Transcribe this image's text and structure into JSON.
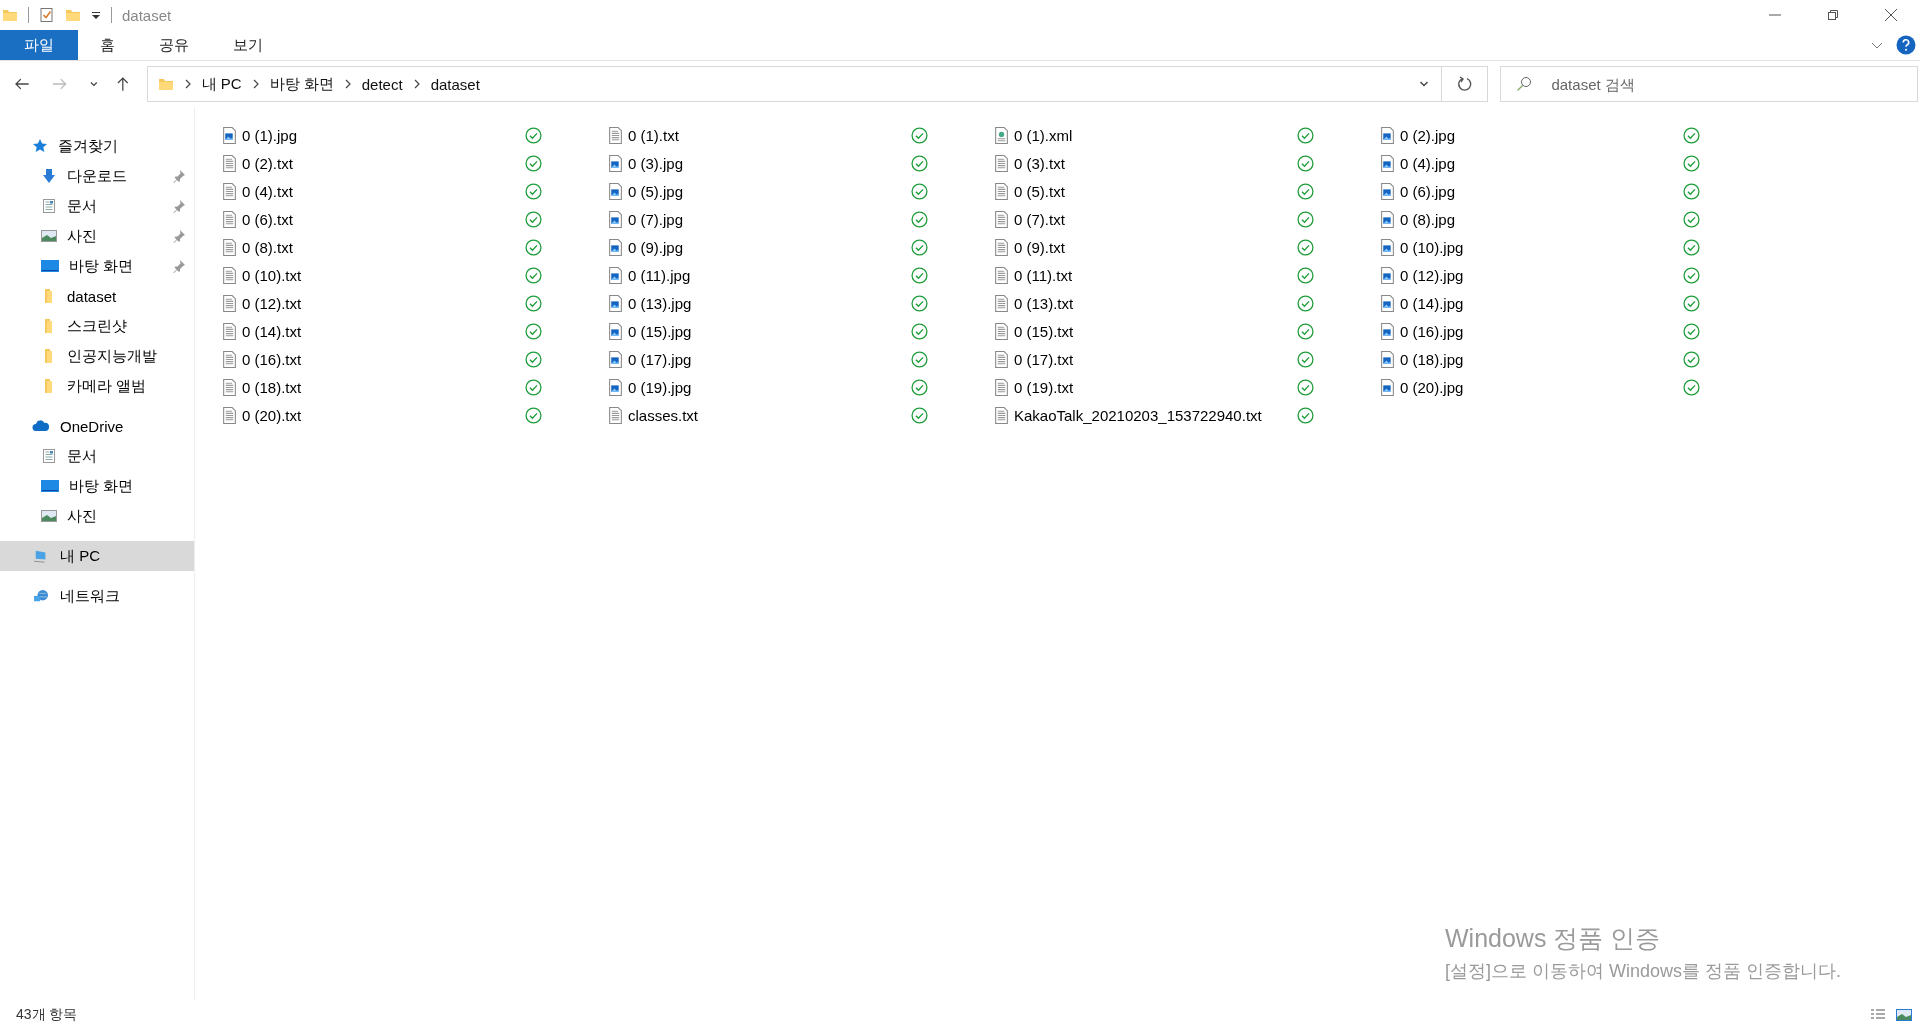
{
  "window": {
    "title": "dataset"
  },
  "ribbon_tabs": [
    {
      "label": "파일",
      "selected": true
    },
    {
      "label": "홈",
      "selected": false
    },
    {
      "label": "공유",
      "selected": false
    },
    {
      "label": "보기",
      "selected": false
    }
  ],
  "breadcrumb": [
    "내 PC",
    "바탕 화면",
    "detect",
    "dataset"
  ],
  "search": {
    "placeholder": "dataset 검색"
  },
  "sidebar": [
    {
      "label": "즐겨찾기",
      "kind": "star",
      "selected": false,
      "children": [
        {
          "label": "다운로드",
          "kind": "download",
          "pinned": true,
          "selected": false
        },
        {
          "label": "문서",
          "kind": "document",
          "pinned": true,
          "selected": false
        },
        {
          "label": "사진",
          "kind": "picture",
          "pinned": true,
          "selected": false
        },
        {
          "label": "바탕 화면",
          "kind": "desktop",
          "pinned": true,
          "selected": false
        },
        {
          "label": "dataset",
          "kind": "folder",
          "pinned": false,
          "selected": false
        },
        {
          "label": "스크린샷",
          "kind": "folder",
          "pinned": false,
          "selected": false
        },
        {
          "label": "인공지능개발",
          "kind": "folder",
          "pinned": false,
          "selected": false
        },
        {
          "label": "카메라 앨범",
          "kind": "folder",
          "pinned": false,
          "selected": false
        }
      ]
    },
    {
      "label": "OneDrive",
      "kind": "cloud",
      "selected": false,
      "children": [
        {
          "label": "문서",
          "kind": "document",
          "pinned": false,
          "selected": false
        },
        {
          "label": "바탕 화면",
          "kind": "desktop",
          "pinned": false,
          "selected": false
        },
        {
          "label": "사진",
          "kind": "picture",
          "pinned": false,
          "selected": false
        }
      ]
    },
    {
      "label": "내 PC",
      "kind": "pc",
      "selected": true
    },
    {
      "label": "네트워크",
      "kind": "network",
      "selected": false
    }
  ],
  "files": [
    {
      "name": "0 (1).jpg",
      "kind": "image",
      "synced": true
    },
    {
      "name": "0 (1).txt",
      "kind": "text",
      "synced": true
    },
    {
      "name": "0 (1).xml",
      "kind": "xml",
      "synced": true
    },
    {
      "name": "0 (2).jpg",
      "kind": "image",
      "synced": true
    },
    {
      "name": "0 (2).txt",
      "kind": "text",
      "synced": true
    },
    {
      "name": "0 (3).jpg",
      "kind": "image",
      "synced": true
    },
    {
      "name": "0 (3).txt",
      "kind": "text",
      "synced": true
    },
    {
      "name": "0 (4).jpg",
      "kind": "image",
      "synced": true
    },
    {
      "name": "0 (4).txt",
      "kind": "text",
      "synced": true
    },
    {
      "name": "0 (5).jpg",
      "kind": "image",
      "synced": true
    },
    {
      "name": "0 (5).txt",
      "kind": "text",
      "synced": true
    },
    {
      "name": "0 (6).jpg",
      "kind": "image",
      "synced": true
    },
    {
      "name": "0 (6).txt",
      "kind": "text",
      "synced": true
    },
    {
      "name": "0 (7).jpg",
      "kind": "image",
      "synced": true
    },
    {
      "name": "0 (7).txt",
      "kind": "text",
      "synced": true
    },
    {
      "name": "0 (8).jpg",
      "kind": "image",
      "synced": true
    },
    {
      "name": "0 (8).txt",
      "kind": "text",
      "synced": true
    },
    {
      "name": "0 (9).jpg",
      "kind": "image",
      "synced": true
    },
    {
      "name": "0 (9).txt",
      "kind": "text",
      "synced": true
    },
    {
      "name": "0 (10).jpg",
      "kind": "image",
      "synced": true
    },
    {
      "name": "0 (10).txt",
      "kind": "text",
      "synced": true
    },
    {
      "name": "0 (11).jpg",
      "kind": "image",
      "synced": true
    },
    {
      "name": "0 (11).txt",
      "kind": "text",
      "synced": true
    },
    {
      "name": "0 (12).jpg",
      "kind": "image",
      "synced": true
    },
    {
      "name": "0 (12).txt",
      "kind": "text",
      "synced": true
    },
    {
      "name": "0 (13).jpg",
      "kind": "image",
      "synced": true
    },
    {
      "name": "0 (13).txt",
      "kind": "text",
      "synced": true
    },
    {
      "name": "0 (14).jpg",
      "kind": "image",
      "synced": true
    },
    {
      "name": "0 (14).txt",
      "kind": "text",
      "synced": true
    },
    {
      "name": "0 (15).jpg",
      "kind": "image",
      "synced": true
    },
    {
      "name": "0 (15).txt",
      "kind": "text",
      "synced": true
    },
    {
      "name": "0 (16).jpg",
      "kind": "image",
      "synced": true
    },
    {
      "name": "0 (16).txt",
      "kind": "text",
      "synced": true
    },
    {
      "name": "0 (17).jpg",
      "kind": "image",
      "synced": true
    },
    {
      "name": "0 (17).txt",
      "kind": "text",
      "synced": true
    },
    {
      "name": "0 (18).jpg",
      "kind": "image",
      "synced": true
    },
    {
      "name": "0 (18).txt",
      "kind": "text",
      "synced": true
    },
    {
      "name": "0 (19).jpg",
      "kind": "image",
      "synced": true
    },
    {
      "name": "0 (19).txt",
      "kind": "text",
      "synced": true
    },
    {
      "name": "0 (20).jpg",
      "kind": "image",
      "synced": true
    },
    {
      "name": "0 (20).txt",
      "kind": "text",
      "synced": true
    },
    {
      "name": "classes.txt",
      "kind": "text",
      "synced": true
    },
    {
      "name": "KakaoTalk_20210203_153722940.txt",
      "kind": "text",
      "synced": true
    }
  ],
  "status_bar": {
    "item_count": "43개 항목"
  },
  "activation_notice": {
    "title": "Windows 정품 인증",
    "message": "[설정]으로 이동하여 Windows를 정품 인증합니다."
  }
}
